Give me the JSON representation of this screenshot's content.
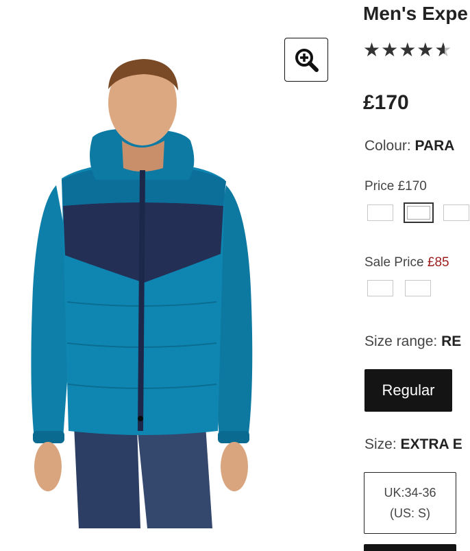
{
  "product": {
    "title": "Men's Expe",
    "rating_stars": "★★★★",
    "rating_half_star": "★",
    "price": "£170"
  },
  "colour": {
    "label": "Colour: ",
    "value": "PARA"
  },
  "price_group": {
    "label": "Price £170",
    "swatch_count": 3,
    "selected_index": 1
  },
  "sale_group": {
    "label": "Sale Price ",
    "value": "£85",
    "swatch_count": 2
  },
  "size_range": {
    "label": "Size range: ",
    "value": "RE",
    "button_label": "Regular"
  },
  "size": {
    "label": "Size: ",
    "value": "EXTRA E",
    "option_line1": "UK:34-36",
    "option_line2": "(US: S)"
  },
  "icons": {
    "zoom": "zoom-in-icon"
  },
  "colors": {
    "jacket_primary": "#0e7fa8",
    "jacket_yoke": "#232f55",
    "sale_red": "#9b1c1c",
    "button_dark": "#141414"
  }
}
